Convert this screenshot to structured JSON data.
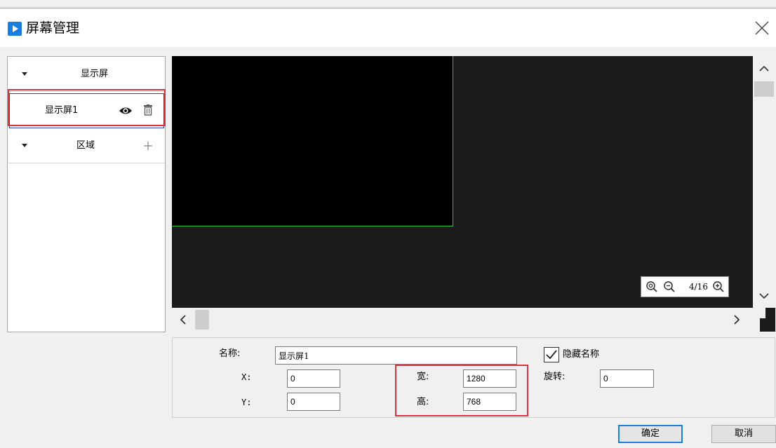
{
  "window": {
    "title": "屏幕管理"
  },
  "tree": {
    "group_screen": "显示屏",
    "screen_item": "显示屏1",
    "group_region": "区域"
  },
  "zoom": {
    "level_text": "4/16"
  },
  "props": {
    "name_label": "名称:",
    "name_value": "显示屏1",
    "x_label": "X:",
    "x_value": "0",
    "y_label": "Y:",
    "y_value": "0",
    "width_label": "宽:",
    "width_value": "1280",
    "height_label": "高:",
    "height_value": "768",
    "rotate_label": "旋转:",
    "rotate_value": "0",
    "hide_name_label": "隐藏名称",
    "hide_name_checked": true
  },
  "buttons": {
    "ok": "确定",
    "cancel": "取消"
  },
  "colors": {
    "accent": "#1a7de0",
    "highlight": "#e0323c",
    "screen_border": "#22c43a",
    "selection": "#2b3bd8"
  }
}
